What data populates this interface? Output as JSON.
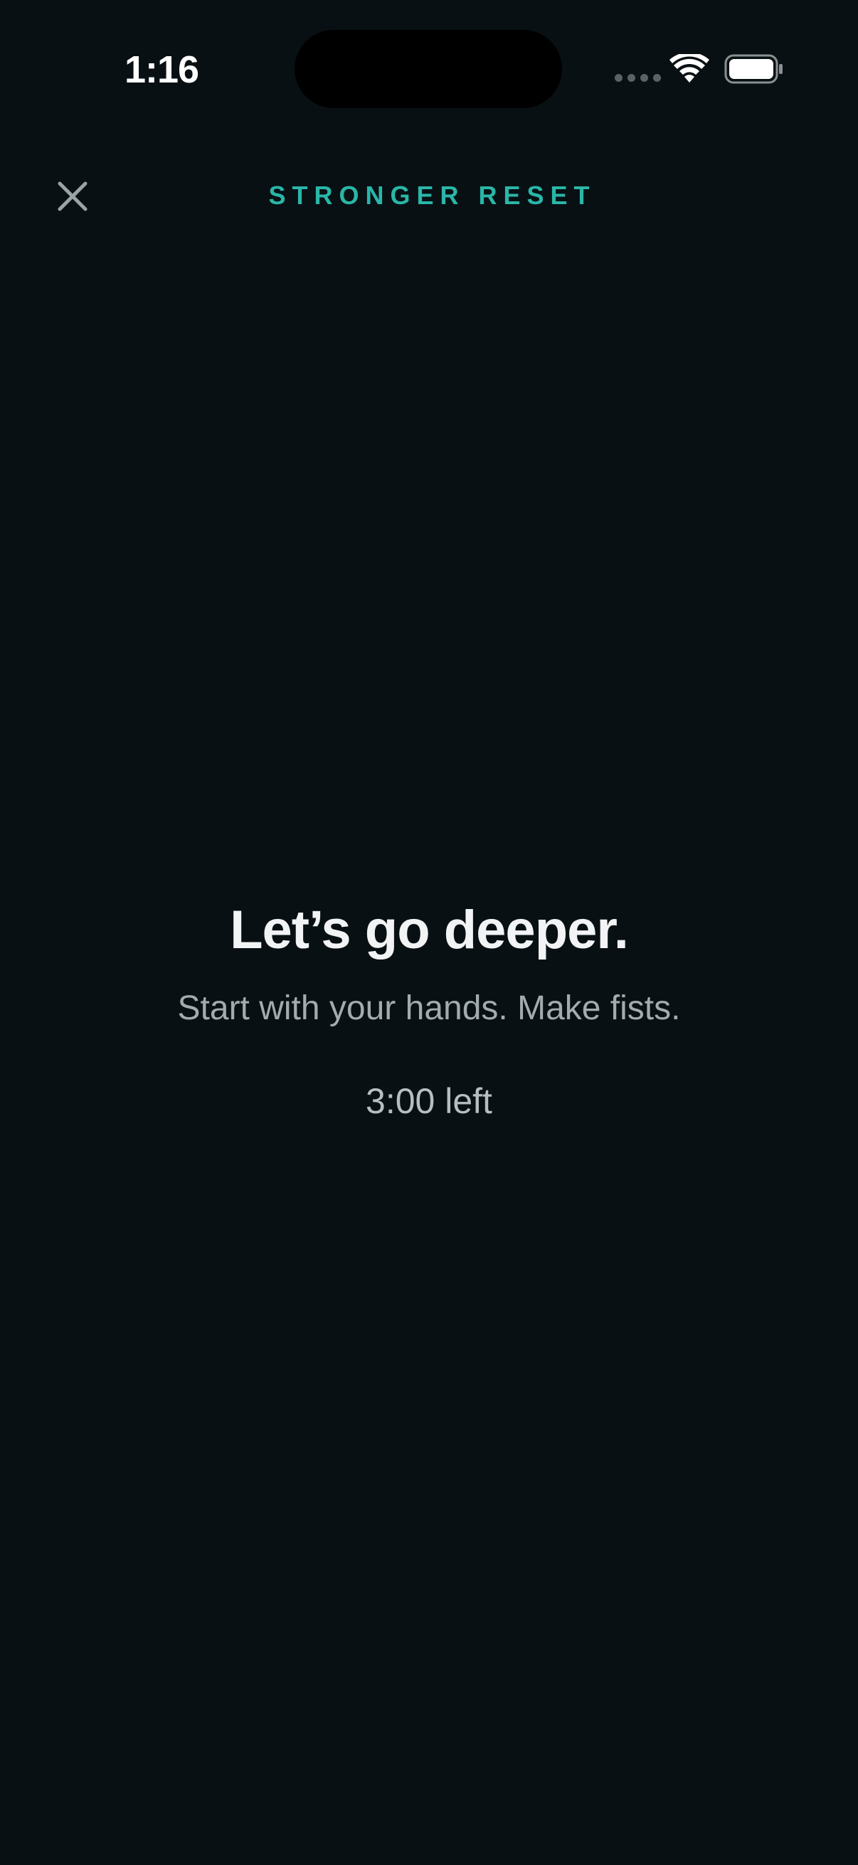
{
  "status_bar": {
    "time": "1:16",
    "icons": [
      "cellular-signal-icon",
      "wifi-icon",
      "battery-icon"
    ]
  },
  "header": {
    "close_icon": "close-icon",
    "title": "STRONGER RESET"
  },
  "main": {
    "headline": "Let’s go deeper.",
    "instruction": "Start with your hands. Make fists.",
    "time_left": "3:00 left"
  },
  "colors": {
    "background": "#081013",
    "accent": "#2ab6a8",
    "headline": "#f1f3f4",
    "secondary_text": "#a2abae",
    "close_icon": "#9aa3a6"
  }
}
